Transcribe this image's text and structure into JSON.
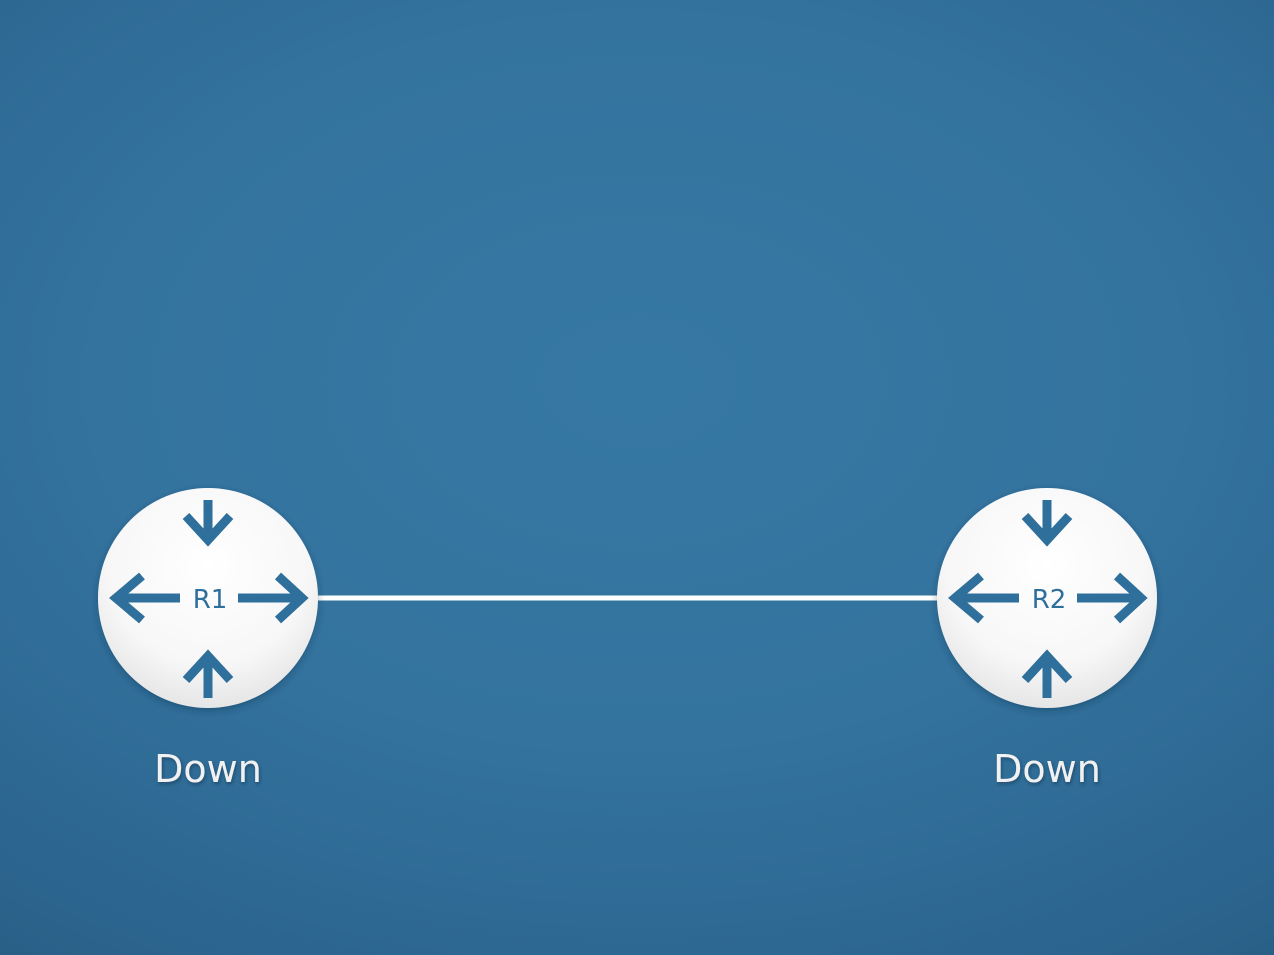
{
  "diagram": {
    "routers": [
      {
        "id": "R1",
        "label": "R1",
        "state": "Down"
      },
      {
        "id": "R2",
        "label": "R2",
        "state": "Down"
      }
    ],
    "links": [
      {
        "from": "R1",
        "to": "R2"
      }
    ]
  },
  "colors": {
    "background": "#33739e",
    "router_fill": "#ffffff",
    "router_icon": "#2f6f9b",
    "link": "#ffffff",
    "state_text": "#f1f1f1"
  }
}
